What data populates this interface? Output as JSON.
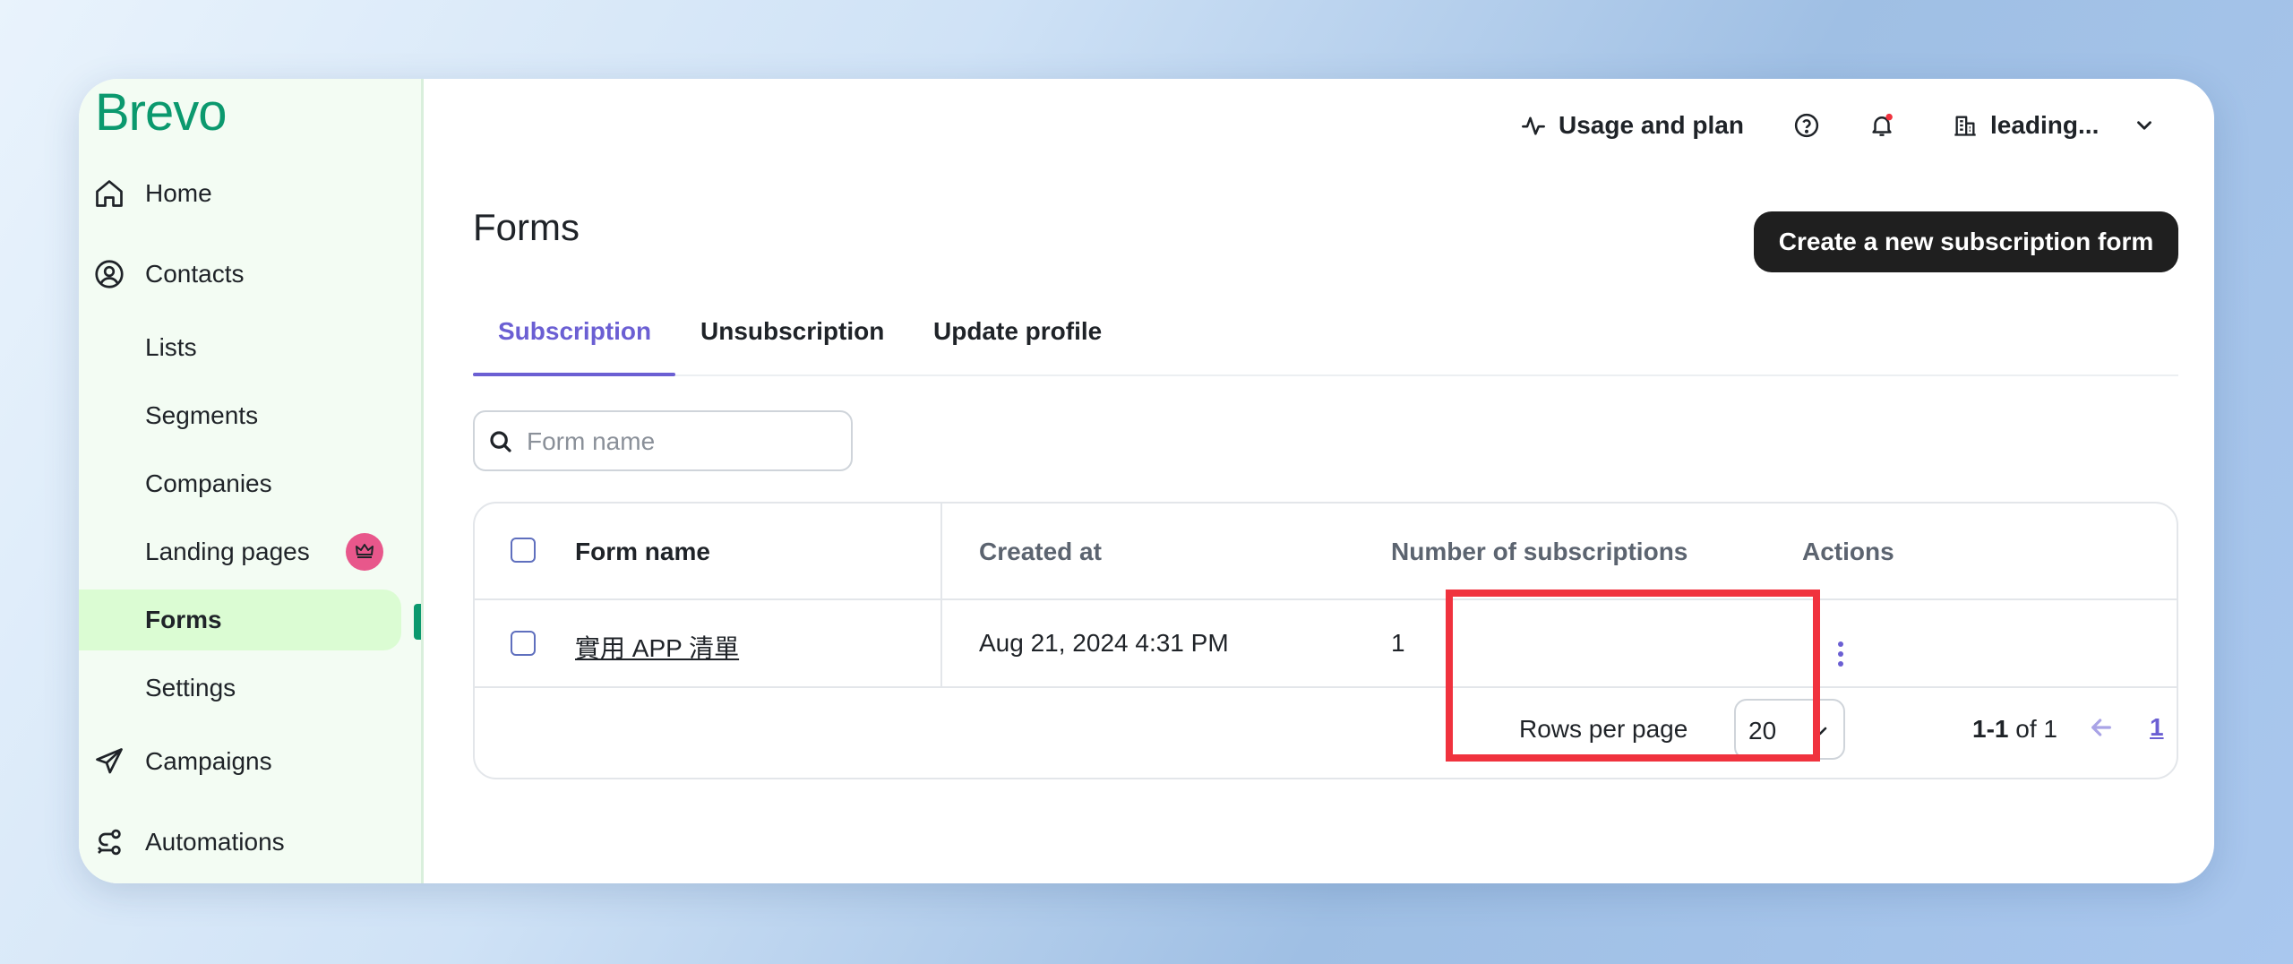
{
  "brand": {
    "logo_text": "Brevo"
  },
  "topbar": {
    "usage_label": "Usage and plan",
    "account_label": "leading..."
  },
  "sidebar": {
    "items": [
      {
        "label": "Home"
      },
      {
        "label": "Contacts"
      },
      {
        "label": "Lists"
      },
      {
        "label": "Segments"
      },
      {
        "label": "Companies"
      },
      {
        "label": "Landing pages"
      },
      {
        "label": "Forms"
      },
      {
        "label": "Settings"
      },
      {
        "label": "Campaigns"
      },
      {
        "label": "Automations"
      }
    ]
  },
  "main": {
    "title": "Forms",
    "create_button": "Create a new subscription form",
    "tabs": [
      {
        "label": "Subscription",
        "active": true
      },
      {
        "label": "Unsubscription"
      },
      {
        "label": "Update profile"
      }
    ],
    "search": {
      "placeholder": "Form name",
      "value": ""
    }
  },
  "table": {
    "headers": {
      "form_name": "Form name",
      "created_at": "Created at",
      "subscriptions": "Number of subscriptions",
      "actions": "Actions"
    },
    "rows": [
      {
        "form_name": "實用 APP 清單",
        "created_at": "Aug 21, 2024 4:31 PM",
        "subscriptions": "1"
      }
    ],
    "pagination": {
      "rows_per_page_label": "Rows per page",
      "rows_per_page_value": "20",
      "range": "1-1",
      "of_label": "of 1",
      "current_page": "1"
    }
  },
  "colors": {
    "brand": "#0b996e",
    "accent": "#6b5fd3",
    "highlight": "#f0323e",
    "active_nav_bg": "#dbfcd3",
    "crown_badge": "#e8578b"
  }
}
